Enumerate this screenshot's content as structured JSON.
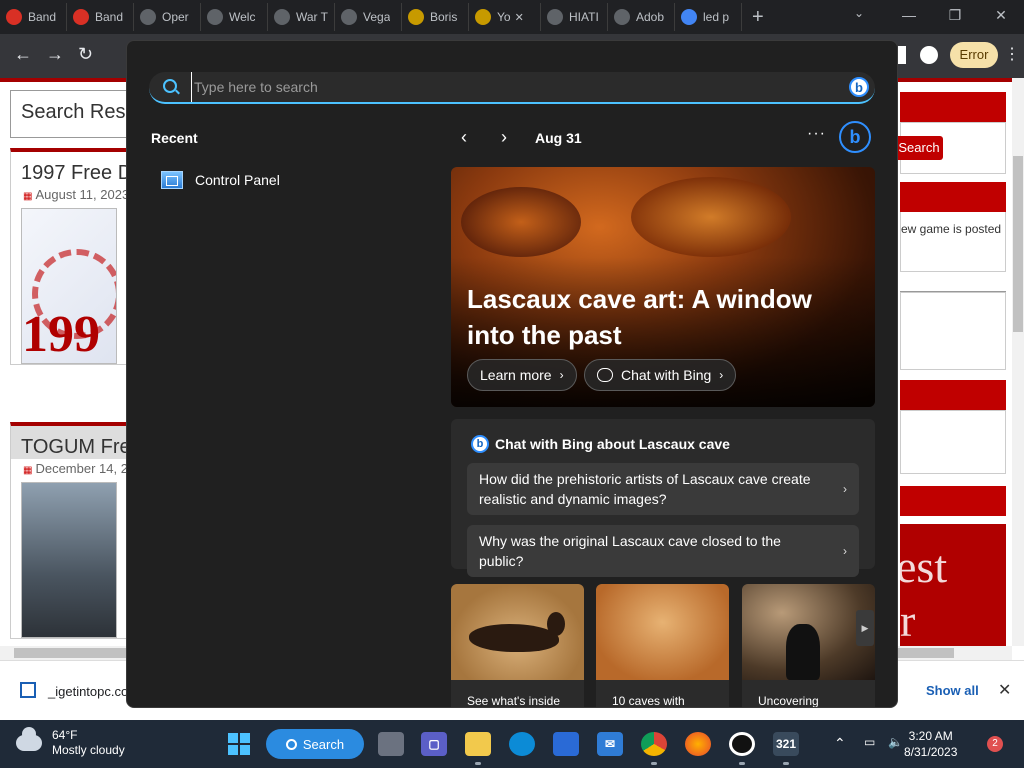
{
  "browser": {
    "tabs": [
      {
        "title": "Band",
        "fav_color": "#d93025"
      },
      {
        "title": "Band",
        "fav_color": "#d93025"
      },
      {
        "title": "Oper",
        "fav_color": "#5f6368"
      },
      {
        "title": "Welc",
        "fav_color": "#5f6368"
      },
      {
        "title": "War T",
        "fav_color": "#5f6368"
      },
      {
        "title": "Vega",
        "fav_color": "#5f6368"
      },
      {
        "title": "Boris",
        "fav_color": "#c79a00"
      },
      {
        "title": "Yo",
        "fav_color": "#c79a00"
      },
      {
        "title": "HIATI",
        "fav_color": "#5f6368"
      },
      {
        "title": "Adob",
        "fav_color": "#5f6368"
      },
      {
        "title": "led p",
        "fav_color": "#4285f4"
      }
    ],
    "error_label": "Error"
  },
  "webpage": {
    "search_result_heading": "Search Result",
    "posts": [
      {
        "title": "1997 Free D",
        "date": "August 11, 2023"
      },
      {
        "title": "TOGUM Free",
        "date": "December 14, 2"
      }
    ],
    "right": {
      "search_button": "Search",
      "snippet": "ew game is posted"
    },
    "download": {
      "filename": "_igetintopc.com",
      "show_all": "Show all"
    }
  },
  "search_flyout": {
    "placeholder": "Type here to search",
    "recent_label": "Recent",
    "recent_items": [
      {
        "label": "Control Panel"
      }
    ],
    "date": "Aug 31",
    "hero": {
      "title": "Lascaux cave art: A window into the past",
      "learn_more": "Learn more",
      "chat_with_bing": "Chat with Bing"
    },
    "chat_card": {
      "heading": "Chat with Bing about Lascaux cave",
      "questions": [
        "How did the prehistoric artists of Lascaux cave create realistic and dynamic images?",
        "Why was the original Lascaux cave closed to the public?"
      ]
    },
    "thumbnails": [
      {
        "caption": "See what's inside"
      },
      {
        "caption": "10 caves with"
      },
      {
        "caption": "Uncovering"
      }
    ]
  },
  "taskbar": {
    "weather": {
      "temp": "64°F",
      "condition": "Mostly cloudy"
    },
    "search_label": "Search",
    "clock": {
      "time": "3:20 AM",
      "date": "8/31/2023"
    },
    "notifications": "2"
  }
}
